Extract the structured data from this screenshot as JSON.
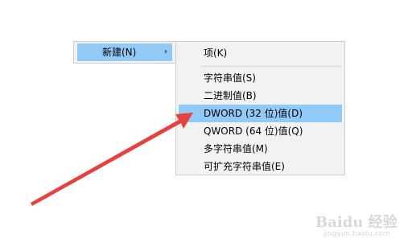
{
  "parent_menu": {
    "item_label": "新建(N)",
    "arrow_glyph": "›"
  },
  "submenu": {
    "items": [
      {
        "label": "项(K)",
        "highlighted": false
      },
      {
        "label": "字符串值(S)",
        "highlighted": false
      },
      {
        "label": "二进制值(B)",
        "highlighted": false
      },
      {
        "label": "DWORD (32 位)值(D)",
        "highlighted": true
      },
      {
        "label": "QWORD (64 位)值(Q)",
        "highlighted": false
      },
      {
        "label": "多字符串值(M)",
        "highlighted": false
      },
      {
        "label": "可扩充字符串值(E)",
        "highlighted": false
      }
    ]
  },
  "annotation": {
    "arrow_color": "#e8403a",
    "points_to": "DWORD (32 位)值(D)"
  },
  "watermark": {
    "text": "Baidu 经验",
    "sub": "jingyan.baidu.com"
  },
  "colors": {
    "menu_bg": "#f2f2f2",
    "highlight": "#91c9f7",
    "border": "#cccccc"
  }
}
